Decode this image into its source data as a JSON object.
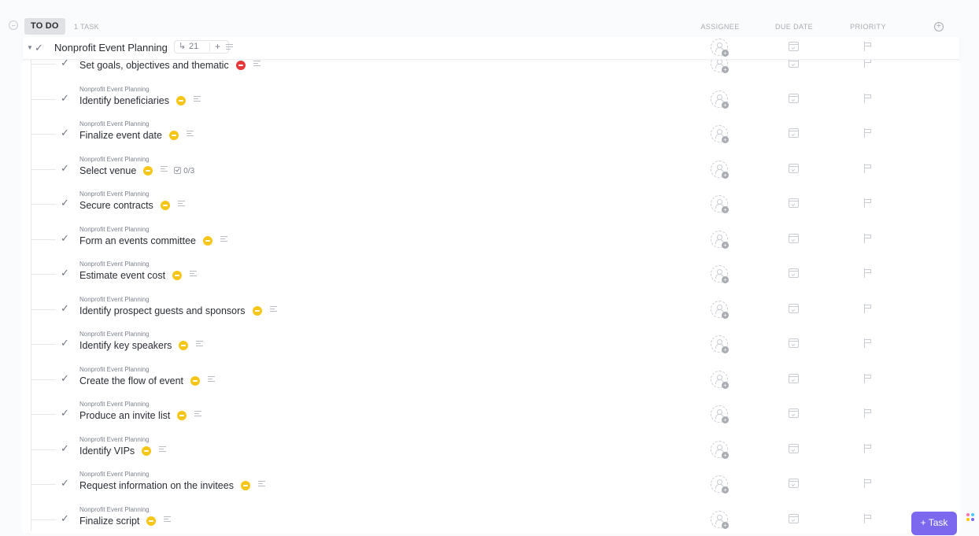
{
  "group": {
    "status": "TO DO",
    "task_count": "1 TASK",
    "columns": {
      "assignee": "ASSIGNEE",
      "due_date": "DUE DATE",
      "priority": "PRIORITY"
    }
  },
  "parent_task": {
    "title": "Nonprofit Event Planning",
    "subtask_count": "21",
    "add": "+"
  },
  "subtasks": [
    {
      "parent": "Nonprofit Event Planning",
      "title": "Set goals, objectives and thematic",
      "priority": "urgent",
      "priority_color": "#e5383b"
    },
    {
      "parent": "Nonprofit Event Planning",
      "title": "Identify beneficiaries",
      "priority": "normal",
      "priority_color": "#f5c518"
    },
    {
      "parent": "Nonprofit Event Planning",
      "title": "Finalize event date",
      "priority": "normal",
      "priority_color": "#f5c518"
    },
    {
      "parent": "Nonprofit Event Planning",
      "title": "Select venue",
      "priority": "normal",
      "priority_color": "#f5c518",
      "checklist": "0/3"
    },
    {
      "parent": "Nonprofit Event Planning",
      "title": "Secure contracts",
      "priority": "normal",
      "priority_color": "#f5c518"
    },
    {
      "parent": "Nonprofit Event Planning",
      "title": "Form an events committee",
      "priority": "normal",
      "priority_color": "#f5c518"
    },
    {
      "parent": "Nonprofit Event Planning",
      "title": "Estimate event cost",
      "priority": "normal",
      "priority_color": "#f5c518"
    },
    {
      "parent": "Nonprofit Event Planning",
      "title": "Identify prospect guests and sponsors",
      "priority": "normal",
      "priority_color": "#f5c518"
    },
    {
      "parent": "Nonprofit Event Planning",
      "title": "Identify key speakers",
      "priority": "normal",
      "priority_color": "#f5c518"
    },
    {
      "parent": "Nonprofit Event Planning",
      "title": "Create the flow of event",
      "priority": "normal",
      "priority_color": "#f5c518"
    },
    {
      "parent": "Nonprofit Event Planning",
      "title": "Produce an invite list",
      "priority": "normal",
      "priority_color": "#f5c518"
    },
    {
      "parent": "Nonprofit Event Planning",
      "title": "Identify VIPs",
      "priority": "normal",
      "priority_color": "#f5c518"
    },
    {
      "parent": "Nonprofit Event Planning",
      "title": "Request information on the invitees",
      "priority": "normal",
      "priority_color": "#f5c518"
    },
    {
      "parent": "Nonprofit Event Planning",
      "title": "Finalize script",
      "priority": "normal",
      "priority_color": "#f5c518"
    }
  ],
  "actions": {
    "add_task": "+ Task"
  },
  "colors": {
    "accent": "#7b68ee",
    "status_pill": "#dfe1e4"
  },
  "icons": {
    "collapse": "minus-circle-icon",
    "check": "checkmark-icon",
    "subtasks": "subtask-branch-icon",
    "description": "description-lines-icon",
    "assignee": "add-assignee-icon",
    "due": "calendar-icon",
    "priority": "flag-icon",
    "add_column": "plus-circle-icon",
    "apps": "apps-grid-icon"
  }
}
